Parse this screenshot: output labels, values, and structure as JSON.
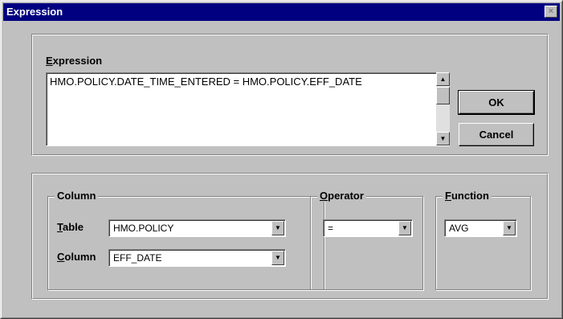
{
  "window": {
    "title": "Expression",
    "close_glyph": "×"
  },
  "expression": {
    "label": "Expression",
    "mnemonic": "E",
    "label_rest": "xpression",
    "value": "HMO.POLICY.DATE_TIME_ENTERED = HMO.POLICY.EFF_DATE"
  },
  "buttons": {
    "ok": "OK",
    "cancel": "Cancel"
  },
  "column_group": {
    "label": "Column",
    "table_label_mnemonic": "T",
    "table_label_rest": "able",
    "table_value": "HMO.POLICY",
    "column_label_mnemonic": "C",
    "column_label_rest": "olumn",
    "column_value": "EFF_DATE"
  },
  "operator_group": {
    "label_mnemonic": "O",
    "label_rest": "perator",
    "value": "="
  },
  "function_group": {
    "label_mnemonic": "F",
    "label_rest": "unction",
    "value": "AVG"
  },
  "icons": {
    "scroll_up": "▲",
    "scroll_down": "▼",
    "dropdown": "▼"
  }
}
